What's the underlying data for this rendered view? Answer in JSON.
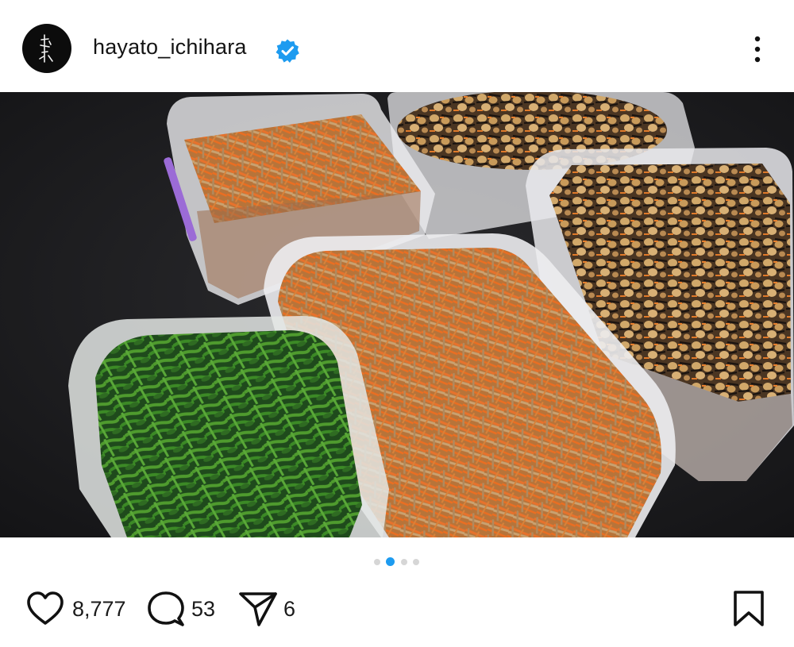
{
  "post": {
    "username": "hayato_ichihara",
    "verified": true,
    "image_alt": "Plastic containers of prepared Japanese side dishes: kinpira burdock and carrot, hijiki seaweed with soybeans, and spinach",
    "carousel": {
      "count": 4,
      "active_index": 1
    },
    "likes": "8,777",
    "comments": "53",
    "shares": "6"
  },
  "icons": {
    "more": "more-vertical-icon",
    "verified": "verified-badge-icon",
    "like": "heart-icon",
    "comment": "comment-bubble-icon",
    "share": "paper-plane-icon",
    "save": "bookmark-icon"
  },
  "colors": {
    "verified_blue": "#1d9bf0",
    "active_dot": "#1d9bf0",
    "inactive_dot": "#d6d6d6",
    "text": "#141414"
  }
}
